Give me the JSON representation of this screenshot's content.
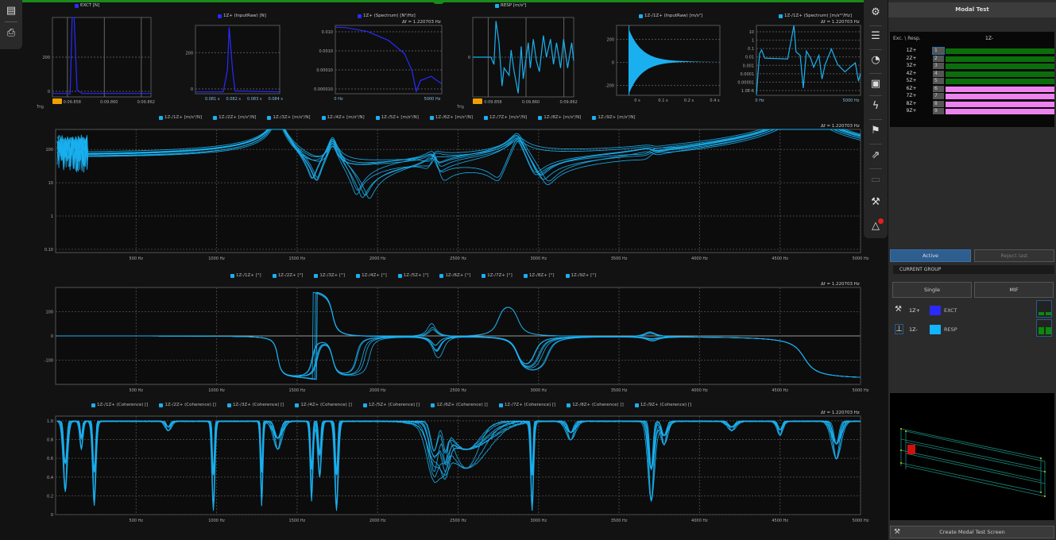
{
  "left_tools": [
    {
      "icon": "layers-icon"
    },
    {
      "icon": "print-icon"
    }
  ],
  "small_charts": [
    {
      "title": "EXCT [N]",
      "color": "#2a2aff",
      "y_ticks": [
        "200",
        "0"
      ],
      "x_ticks": [
        "0:09.858",
        "0:09.860",
        "0:09.862"
      ],
      "trigger_label": "Trig",
      "points": [
        [
          0,
          2
        ],
        [
          0.14,
          2
        ],
        [
          0.18,
          0
        ],
        [
          0.2,
          380
        ],
        [
          0.22,
          380
        ],
        [
          0.25,
          20
        ],
        [
          0.3,
          2
        ],
        [
          1,
          2
        ]
      ],
      "ylim": [
        -15,
        380
      ]
    },
    {
      "title": "1Z+ (InputRaw) [N]",
      "color": "#2a2aff",
      "y_ticks": [
        "200",
        "0"
      ],
      "x_ticks": [
        "0.081 s",
        "0.082 s",
        "0.083 s",
        "0.084 s"
      ],
      "points": [
        [
          0,
          0
        ],
        [
          0.33,
          0
        ],
        [
          0.38,
          120
        ],
        [
          0.4,
          350
        ],
        [
          0.44,
          120
        ],
        [
          0.47,
          5
        ],
        [
          1,
          0
        ]
      ],
      "ylim": [
        -10,
        360
      ]
    },
    {
      "title": "1Z+ (Spectrum) [N²/Hz]",
      "color": "#2a2aff",
      "df": "Δf = 1.220703 Hz",
      "y_ticks": [
        "0.010",
        "0.0010",
        "0.00010",
        "0.000010"
      ],
      "x_ticks": [
        "0 Hz",
        "5000 Hz"
      ],
      "log": true,
      "points": [
        [
          0,
          0.02
        ],
        [
          0.1,
          0.019
        ],
        [
          0.3,
          0.012
        ],
        [
          0.5,
          0.004
        ],
        [
          0.65,
          0.0008
        ],
        [
          0.72,
          0.0001
        ],
        [
          0.76,
          8e-06
        ],
        [
          0.8,
          3e-05
        ],
        [
          0.9,
          5e-05
        ],
        [
          1,
          2e-05
        ]
      ],
      "ylim": [
        6e-06,
        0.025
      ]
    },
    {
      "title": "RESP [m/s²]",
      "color": "#1ab0f0",
      "y_ticks": [
        "0"
      ],
      "x_ticks": [
        "0:09.858",
        "0:09.860",
        "0:09.862"
      ],
      "trigger_label": "Trig",
      "points": [
        [
          0,
          0
        ],
        [
          0.18,
          0
        ],
        [
          0.21,
          -2
        ],
        [
          0.23,
          10
        ],
        [
          0.26,
          4
        ],
        [
          0.29,
          -8
        ],
        [
          0.31,
          -3
        ],
        [
          0.36,
          -5
        ],
        [
          0.38,
          2
        ],
        [
          0.41,
          -4
        ],
        [
          0.45,
          -10
        ],
        [
          0.48,
          3
        ],
        [
          0.5,
          -6
        ],
        [
          0.55,
          4
        ],
        [
          0.57,
          -3
        ],
        [
          0.6,
          5
        ],
        [
          0.63,
          -1
        ],
        [
          0.66,
          -4
        ],
        [
          0.7,
          6
        ],
        [
          0.73,
          0
        ],
        [
          0.77,
          5
        ],
        [
          0.8,
          -2
        ],
        [
          0.83,
          4
        ],
        [
          0.87,
          -3
        ],
        [
          0.9,
          5
        ],
        [
          0.94,
          -3
        ],
        [
          0.98,
          4
        ],
        [
          1,
          -1
        ]
      ],
      "ylim": [
        -11,
        11
      ]
    },
    {
      "title": "1Z-/1Z+ (InputRaw) [m/s²]",
      "color": "#1ab0f0",
      "y_ticks": [
        "200",
        "0",
        "-200"
      ],
      "x_ticks": [
        "0 s",
        "0.1 s",
        "0.2 s",
        "0.4 s"
      ],
      "decay": true,
      "ylim": [
        -280,
        300
      ]
    },
    {
      "title": "1Z-/1Z+ (Spectrum) [m/s²²/Hz]",
      "color": "#1ab0f0",
      "df": "Δf = 1.220703 Hz",
      "y_ticks": [
        "10",
        "1",
        "0.1",
        "0.01",
        "0.001",
        "0.0001",
        "0.00001",
        "1.0E-6"
      ],
      "x_ticks": [
        "0 Hz",
        "5000 Hz"
      ],
      "log": true,
      "points": [
        [
          0,
          1e-06
        ],
        [
          0.03,
          0.03
        ],
        [
          0.05,
          0.08
        ],
        [
          0.08,
          0.01
        ],
        [
          0.3,
          0.008
        ],
        [
          0.36,
          40
        ],
        [
          0.38,
          0.05
        ],
        [
          0.42,
          0.02
        ],
        [
          0.45,
          5e-06
        ],
        [
          0.48,
          0.06
        ],
        [
          0.52,
          0.01
        ],
        [
          0.55,
          0.001
        ],
        [
          0.6,
          0.02
        ],
        [
          0.63,
          5e-05
        ],
        [
          0.66,
          0.002
        ],
        [
          0.72,
          0.1
        ],
        [
          0.78,
          0.002
        ],
        [
          0.85,
          0.0003
        ],
        [
          0.9,
          0.001
        ],
        [
          0.95,
          0.003
        ],
        [
          0.98,
          3e-05
        ],
        [
          1,
          0.0002
        ]
      ],
      "ylim": [
        8e-07,
        40
      ]
    }
  ],
  "chart_data": [
    {
      "type": "line",
      "name": "frf-magnitude",
      "legend": [
        "1Z-/1Z+ [m/s²/N]",
        "1Z-/2Z+ [m/s²/N]",
        "1Z-/3Z+ [m/s²/N]",
        "1Z-/4Z+ [m/s²/N]",
        "1Z-/5Z+ [m/s²/N]",
        "1Z-/6Z+ [m/s²/N]",
        "1Z-/7Z+ [m/s²/N]",
        "1Z-/8Z+ [m/s²/N]",
        "1Z-/9Z+ [m/s²/N]"
      ],
      "df": "Δf = 1.220703 Hz",
      "y_scale": "log",
      "ylim": [
        0.08,
        400
      ],
      "y_ticks": [
        {
          "v": 100,
          "l": "100"
        },
        {
          "v": 10,
          "l": "10"
        },
        {
          "v": 1,
          "l": "1"
        },
        {
          "v": 0.1,
          "l": "0.10"
        }
      ],
      "xlim": [
        0,
        5000
      ],
      "x_ticks": [
        "500 Hz",
        "1000 Hz",
        "1500 Hz",
        "2000 Hz",
        "2500 Hz",
        "3000 Hz",
        "3500 Hz",
        "4000 Hz",
        "4500 Hz",
        "5000 Hz"
      ],
      "grid": true,
      "color": "#1ab0f0",
      "modes_hz": [
        1380,
        1720,
        2350,
        2870,
        3700,
        4650
      ],
      "damping": 0.012,
      "participation": [
        [
          1,
          0.8,
          0.3,
          0.6,
          0.2,
          1
        ],
        [
          1,
          -0.6,
          0.5,
          0.4,
          -0.3,
          0.9
        ],
        [
          0.9,
          0.9,
          -0.2,
          0.7,
          0.25,
          0.8
        ],
        [
          0.8,
          -0.5,
          0.4,
          -0.5,
          0.2,
          1.1
        ],
        [
          1,
          0.7,
          0.3,
          0.5,
          -0.25,
          0.7
        ],
        [
          0.7,
          -0.8,
          -0.35,
          0.6,
          0.3,
          0.9
        ],
        [
          0.9,
          0.6,
          0.45,
          -0.4,
          0.2,
          1
        ],
        [
          0.85,
          -0.7,
          0.3,
          0.55,
          -0.2,
          0.8
        ],
        [
          0.95,
          0.5,
          -0.4,
          0.45,
          0.3,
          0.95
        ]
      ],
      "mode_gain": [
        2.3,
        0.35,
        0.12,
        0.35,
        0.06,
        0.9
      ]
    },
    {
      "type": "line",
      "name": "frf-phase",
      "legend": [
        "1Z-/1Z+ [°]",
        "1Z-/2Z+ [°]",
        "1Z-/3Z+ [°]",
        "1Z-/4Z+ [°]",
        "1Z-/5Z+ [°]",
        "1Z-/6Z+ [°]",
        "1Z-/7Z+ [°]",
        "1Z-/8Z+ [°]",
        "1Z-/9Z+ [°]"
      ],
      "df": "Δf = 1.220703 Hz",
      "ylim": [
        -200,
        200
      ],
      "y_ticks": [
        {
          "v": 100,
          "l": "100"
        },
        {
          "v": 0,
          "l": "0"
        },
        {
          "v": -100,
          "l": "-100"
        }
      ],
      "xlim": [
        0,
        5000
      ],
      "x_ticks": [
        "500 Hz",
        "1000 Hz",
        "1500 Hz",
        "2000 Hz",
        "2500 Hz",
        "3000 Hz",
        "3500 Hz",
        "4000 Hz",
        "4500 Hz",
        "5000 Hz"
      ],
      "grid": true,
      "color": "#1ab0f0"
    },
    {
      "type": "line",
      "name": "coherence",
      "legend": [
        "1Z-/1Z+ (Coherence) []",
        "1Z-/2Z+ (Coherence) []",
        "1Z-/3Z+ (Coherence) []",
        "1Z-/4Z+ (Coherence) []",
        "1Z-/5Z+ (Coherence) []",
        "1Z-/6Z+ (Coherence) []",
        "1Z-/7Z+ (Coherence) []",
        "1Z-/8Z+ (Coherence) []",
        "1Z-/9Z+ (Coherence) []"
      ],
      "df": "Δf = 1.220703 Hz",
      "ylim": [
        0,
        1.05
      ],
      "y_ticks": [
        {
          "v": 1,
          "l": "1.0"
        },
        {
          "v": 0.8,
          "l": "0.8"
        },
        {
          "v": 0.6,
          "l": "0.6"
        },
        {
          "v": 0.4,
          "l": "0.4"
        },
        {
          "v": 0.2,
          "l": "0.2"
        },
        {
          "v": 0,
          "l": "0"
        }
      ],
      "xlim": [
        0,
        5000
      ],
      "x_ticks": [
        "500 Hz",
        "1000 Hz",
        "1500 Hz",
        "2000 Hz",
        "2500 Hz",
        "3000 Hz",
        "3500 Hz",
        "4000 Hz",
        "4500 Hz",
        "5000 Hz"
      ],
      "grid": true,
      "color": "#1ab0f0",
      "dips": [
        [
          60,
          0.75,
          15
        ],
        [
          160,
          0.3,
          10
        ],
        [
          240,
          0.9,
          12
        ],
        [
          700,
          0.1,
          20
        ],
        [
          980,
          0.95,
          10
        ],
        [
          1280,
          0.9,
          8
        ],
        [
          1380,
          0.3,
          30
        ],
        [
          1590,
          0.85,
          10
        ],
        [
          1640,
          0.6,
          12
        ],
        [
          1745,
          0.95,
          12
        ],
        [
          2350,
          0.5,
          40
        ],
        [
          2420,
          0.35,
          25
        ],
        [
          2550,
          0.5,
          150
        ],
        [
          2960,
          0.95,
          10
        ],
        [
          3200,
          0.2,
          30
        ],
        [
          3700,
          0.85,
          20
        ],
        [
          3780,
          0.25,
          25
        ],
        [
          4200,
          0.1,
          30
        ],
        [
          4500,
          0.15,
          20
        ],
        [
          4850,
          0.4,
          30
        ]
      ]
    }
  ],
  "right_tools": [
    {
      "icon": "gear-icon"
    },
    {
      "icon": "table-icon"
    },
    {
      "icon": "gauge-icon"
    },
    {
      "icon": "report-icon"
    },
    {
      "icon": "lightning-icon"
    },
    {
      "icon": "flag-icon"
    },
    {
      "icon": "export-icon"
    },
    {
      "icon": "car-icon"
    },
    {
      "icon": "hammer-icon"
    },
    {
      "icon": "warning-icon",
      "badge": true
    }
  ],
  "panel": {
    "title": "Modal Test",
    "table_header_left": "Exc. \\ Resp.",
    "table_header_right": "1Z-",
    "rows": [
      {
        "label": "1Z+",
        "num": "1",
        "color": "#0b6e0b"
      },
      {
        "label": "2Z+",
        "num": "2",
        "color": "#0b6e0b"
      },
      {
        "label": "3Z+",
        "num": "3",
        "color": "#0b6e0b"
      },
      {
        "label": "4Z+",
        "num": "4",
        "color": "#0b6e0b"
      },
      {
        "label": "5Z+",
        "num": "5",
        "color": "#0b6e0b"
      },
      {
        "label": "6Z+",
        "num": "6",
        "color": "#ee82ee"
      },
      {
        "label": "7Z+",
        "num": "7",
        "color": "#ee82ee"
      },
      {
        "label": "8Z+",
        "num": "8",
        "color": "#ee82ee"
      },
      {
        "label": "9Z+",
        "num": "9",
        "color": "#ee82ee"
      }
    ],
    "active_label": "Active",
    "reject_label": "Reject last",
    "current_group": "CURRENT GROUP",
    "single_label": "Single",
    "mif_label": "MIF",
    "channels": [
      {
        "icon": "hammer-icon",
        "point": "1Z+",
        "name": "EXCT",
        "color": "#2a2aff"
      },
      {
        "icon": "accelerometer-icon",
        "point": "1Z-",
        "name": "RESP",
        "color": "#11b5ff"
      }
    ],
    "create_label": "Create Modal Test Screen"
  }
}
